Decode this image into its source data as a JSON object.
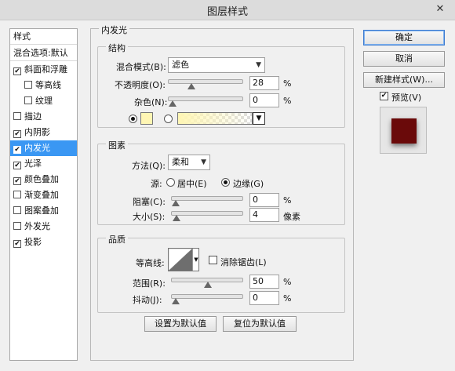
{
  "window": {
    "title": "图层样式",
    "close": "✕"
  },
  "style_list": {
    "header": "样式",
    "blend_options": "混合选项:默认",
    "items": [
      {
        "label": "斜面和浮雕",
        "checked": true,
        "selected": false,
        "indent": false
      },
      {
        "label": "等高线",
        "checked": false,
        "selected": false,
        "indent": true
      },
      {
        "label": "纹理",
        "checked": false,
        "selected": false,
        "indent": true
      },
      {
        "label": "描边",
        "checked": false,
        "selected": false,
        "indent": false
      },
      {
        "label": "内阴影",
        "checked": true,
        "selected": false,
        "indent": false
      },
      {
        "label": "内发光",
        "checked": true,
        "selected": true,
        "indent": false
      },
      {
        "label": "光泽",
        "checked": true,
        "selected": false,
        "indent": false
      },
      {
        "label": "颜色叠加",
        "checked": true,
        "selected": false,
        "indent": false
      },
      {
        "label": "渐变叠加",
        "checked": false,
        "selected": false,
        "indent": false
      },
      {
        "label": "图案叠加",
        "checked": false,
        "selected": false,
        "indent": false
      },
      {
        "label": "外发光",
        "checked": false,
        "selected": false,
        "indent": false
      },
      {
        "label": "投影",
        "checked": true,
        "selected": false,
        "indent": false
      }
    ]
  },
  "panel": {
    "title": "内发光",
    "structure": {
      "label": "结构",
      "blend_mode_label": "混合模式(B):",
      "blend_mode_value": "滤色",
      "opacity_label": "不透明度(O):",
      "opacity_value": "28",
      "opacity_unit": "%",
      "noise_label": "杂色(N):",
      "noise_value": "0",
      "noise_unit": "%",
      "color_swatch": "#fff6b4",
      "gradient_start": "#fff6b4",
      "opacity_fraction": 0.28,
      "noise_fraction": 0
    },
    "elements": {
      "label": "图素",
      "technique_label": "方法(Q):",
      "technique_value": "柔和",
      "source_label": "源:",
      "source_center": "居中(E)",
      "source_edge": "边缘(G)",
      "choke_label": "阻塞(C):",
      "choke_value": "0",
      "choke_unit": "%",
      "size_label": "大小(S):",
      "size_value": "4",
      "size_unit": "像素",
      "choke_fraction": 0,
      "size_fraction": 0.016
    },
    "quality": {
      "label": "品质",
      "contour_label": "等高线:",
      "antialias_label": "消除锯齿(L)",
      "range_label": "范围(R):",
      "range_value": "50",
      "range_unit": "%",
      "jitter_label": "抖动(J):",
      "jitter_value": "0",
      "jitter_unit": "%",
      "range_fraction": 0.5,
      "jitter_fraction": 0
    },
    "set_default": "设置为默认值",
    "reset_default": "复位为默认值"
  },
  "actions": {
    "ok": "确定",
    "cancel": "取消",
    "new_style": "新建样式(W)...",
    "preview_label": "预览(V)",
    "preview_checked": true
  },
  "colors": {
    "selection": "#3a97f3",
    "preview_fill": "#6a0a0a"
  }
}
